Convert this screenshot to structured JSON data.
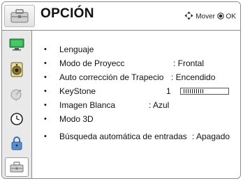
{
  "header": {
    "title": "OPCIÓN",
    "icon": "toolbox-icon",
    "hint_move": "Mover",
    "hint_ok": "OK"
  },
  "sidebar": {
    "items": [
      {
        "icon": "picture-monitor-icon",
        "active": false
      },
      {
        "icon": "speaker-icon",
        "active": false
      },
      {
        "icon": "satellite-dish-icon",
        "active": false
      },
      {
        "icon": "clock-icon",
        "active": false
      },
      {
        "icon": "lock-icon",
        "active": false
      },
      {
        "icon": "toolbox-icon",
        "active": true
      }
    ]
  },
  "menu": {
    "items": [
      {
        "label": "Lenguaje",
        "value": ""
      },
      {
        "label": "Modo de Proyecc",
        "value": ": Frontal"
      },
      {
        "label": "Auto corrección de Trapecio",
        "value": ": Encendido"
      },
      {
        "label": "KeyStone",
        "value": "1",
        "slider_level": 0.5
      },
      {
        "label": "Imagen Blanca",
        "value": ": Azul"
      },
      {
        "label": "Modo 3D",
        "value": ""
      },
      {
        "label": "Búsqueda automática de entradas",
        "value": ": Apagado"
      }
    ]
  },
  "colors": {
    "accent_green": "#2fa84f",
    "border": "#8c8c8c",
    "sidebar_bg": "#e9e9e9"
  }
}
